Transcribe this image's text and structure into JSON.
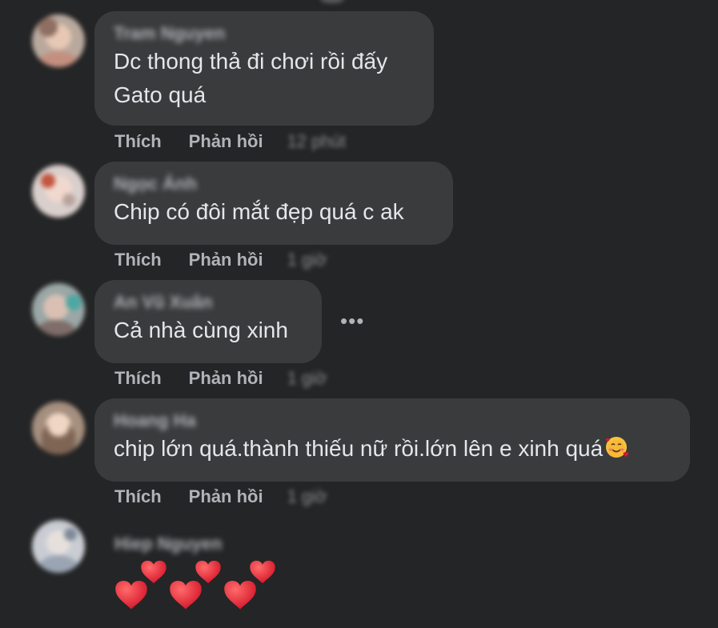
{
  "comments": [
    {
      "author": "Tram Nguyen",
      "lines": [
        "Dc thong thả đi chơi rồi đấy",
        "Gato quá"
      ],
      "like_label": "Thích",
      "reply_label": "Phản hồi",
      "time": "12 phút"
    },
    {
      "author": "Ngọc Ánh",
      "lines": [
        "Chip có đôi mắt đẹp quá c ak"
      ],
      "like_label": "Thích",
      "reply_label": "Phản hồi",
      "time": "1 giờ"
    },
    {
      "author": "An Vũ Xuân",
      "lines": [
        "Cả nhà cùng xinh"
      ],
      "like_label": "Thích",
      "reply_label": "Phản hồi",
      "time": "1 giờ",
      "more_label": "•••"
    },
    {
      "author": "Hoang Ha",
      "lines": [
        "chip lớn quá.thành thiếu nữ rồi.lớn lên e xinh quá"
      ],
      "like_label": "Thích",
      "reply_label": "Phản hồi",
      "time": "1 giờ",
      "emoji": "smiling-face-with-hearts"
    },
    {
      "author": "Hiep Nguyen",
      "sticker": "hearts-sticker"
    }
  ],
  "colors": {
    "background": "#242526",
    "bubble": "#3a3b3c",
    "text": "#e4e6eb",
    "secondary": "#b0b3b8",
    "heart": "#e0162b"
  }
}
